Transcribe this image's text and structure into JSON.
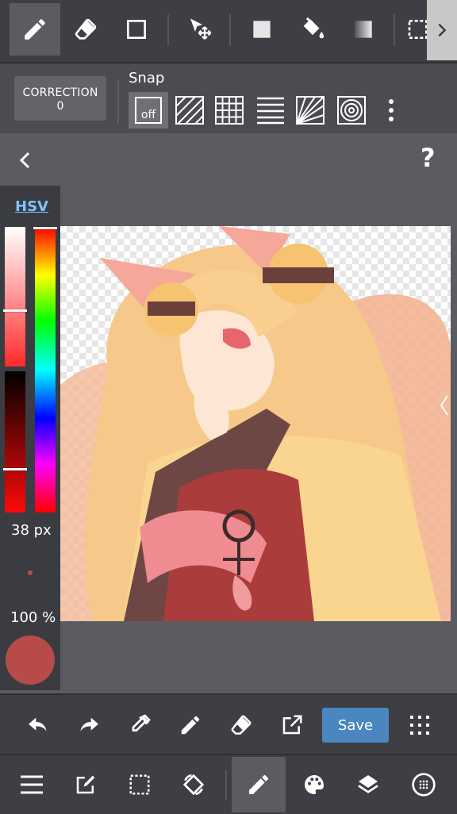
{
  "top_toolbar": {
    "tools": [
      {
        "name": "pen-tool",
        "icon": "pencil-icon",
        "selected": true
      },
      {
        "name": "eraser-tool",
        "icon": "eraser-icon"
      },
      {
        "name": "shape-tool",
        "icon": "square-outline-icon"
      },
      {
        "name": "move-tool",
        "icon": "move-arrow-icon"
      },
      {
        "name": "fill-rect-tool",
        "icon": "filled-square-icon"
      },
      {
        "name": "bucket-tool",
        "icon": "paint-bucket-icon"
      },
      {
        "name": "gradient-tool",
        "icon": "gradient-icon"
      },
      {
        "name": "select-tool",
        "icon": "marquee-select-icon"
      },
      {
        "name": "expand-tool",
        "icon": "chevron-right-icon"
      }
    ]
  },
  "correction": {
    "label": "CORRECTION",
    "value": "0"
  },
  "snap": {
    "label": "Snap",
    "off_label": "off",
    "options": [
      "parallel-lines-icon",
      "grid-icon",
      "horizontal-lines-icon",
      "radial-lines-icon",
      "concentric-circles-icon"
    ]
  },
  "nav": {
    "back_icon": "chevron-left-icon",
    "help_label": "?"
  },
  "color_panel": {
    "mode_label": "HSV",
    "brush_size": "38 px",
    "opacity": "100 %",
    "current_color": "#b84a4a",
    "saturation_level": 0.73,
    "value_level": 0.7,
    "hue_level": 0.0
  },
  "bottom_toolbar": {
    "save_label": "Save",
    "actions": [
      "undo-icon",
      "redo-icon",
      "eyedropper-icon",
      "pencil-icon",
      "eraser-icon",
      "export-icon",
      "dots-grid-icon"
    ]
  },
  "main_nav": {
    "items": [
      "menu-icon",
      "edit-icon",
      "select-icon",
      "rotate-icon",
      "pencil-icon",
      "palette-icon",
      "layers-icon",
      "material-icon"
    ]
  },
  "colors": {
    "accent": "#4a86c0",
    "hsv_link": "#7fc3ff"
  }
}
